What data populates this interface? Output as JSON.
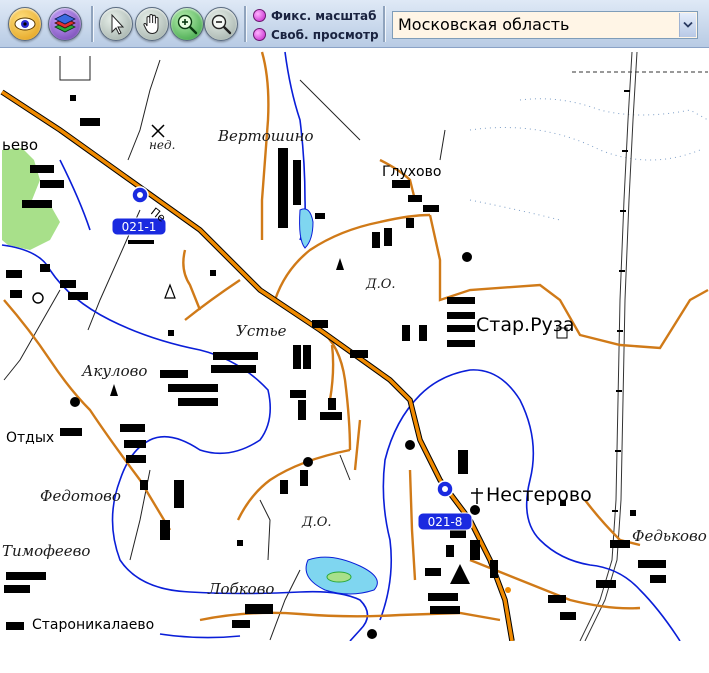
{
  "toolbar": {
    "buttons": [
      {
        "name": "layers-eye-button",
        "icon": "eye-icon",
        "color": "#f0b020"
      },
      {
        "name": "layers-stack-button",
        "icon": "layers-icon",
        "color": "#6a3aa8"
      },
      {
        "name": "select-tool-button",
        "icon": "pointer-arrow-icon",
        "color": "#9aa8a2"
      },
      {
        "name": "pan-tool-button",
        "icon": "hand-icon",
        "color": "#9aa8a2"
      },
      {
        "name": "zoom-in-button",
        "icon": "zoom-in-icon",
        "color": "#2f9a3a"
      },
      {
        "name": "zoom-out-button",
        "icon": "zoom-out-icon",
        "color": "#9aa8a2"
      }
    ],
    "fixed_scale_label": "Фикс. масштаб",
    "free_view_label": "Своб. просмотр",
    "region_select": {
      "value": "Московская область"
    }
  },
  "map": {
    "colors": {
      "road_main": "#f08a00",
      "road_secondary": "#d07a18",
      "river": "#0a1ed8",
      "building": "#000000",
      "forest": "#a8e08a",
      "marker": "#1a2ae0"
    },
    "places": [
      {
        "id": "vertoshino",
        "text": "Вертошино",
        "style": "italic"
      },
      {
        "id": "glukhovo",
        "text": "Глухово",
        "style": "sans"
      },
      {
        "id": "evo",
        "text": "ьево",
        "style": "sans"
      },
      {
        "id": "ned",
        "text": "нед.",
        "style": "italic"
      },
      {
        "id": "do1",
        "text": "Д.О.",
        "style": "italic"
      },
      {
        "id": "star-ruza",
        "text": "Стар.Руза",
        "style": "sans-big"
      },
      {
        "id": "ustie",
        "text": "Устье",
        "style": "italic"
      },
      {
        "id": "akulovo",
        "text": "Акулово",
        "style": "italic"
      },
      {
        "id": "otdykh",
        "text": "Отдых",
        "style": "sans"
      },
      {
        "id": "nesterovo",
        "text": "Нестерово",
        "style": "sans-big"
      },
      {
        "id": "fedotovo",
        "text": "Федотово",
        "style": "italic"
      },
      {
        "id": "do2",
        "text": "Д.О.",
        "style": "italic"
      },
      {
        "id": "timofeevo",
        "text": "Тимофеево",
        "style": "italic"
      },
      {
        "id": "fedkovo",
        "text": "Федьково",
        "style": "italic"
      },
      {
        "id": "lobkovo",
        "text": "Лобково",
        "style": "italic"
      },
      {
        "id": "staronikolaevo",
        "text": "Староникалаево",
        "style": "sans"
      }
    ],
    "markers": [
      {
        "id": "cam-021-1",
        "label": "021-1"
      },
      {
        "id": "cam-021-8",
        "label": "021-8"
      }
    ],
    "partial_label": "Пе"
  }
}
